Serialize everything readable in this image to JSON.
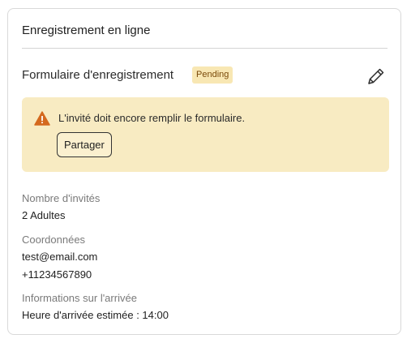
{
  "card": {
    "title": "Enregistrement en ligne"
  },
  "form": {
    "title": "Formulaire d'enregistrement",
    "status_badge": "Pending"
  },
  "alert": {
    "message": "L'invité doit encore remplir le formulaire.",
    "share_label": "Partager"
  },
  "details": {
    "guests_label": "Nombre d'invités",
    "guests_value": "2 Adultes",
    "contact_label": "Coordonnées",
    "email": "test@email.com",
    "phone": "+11234567890",
    "arrival_label": "Informations sur l'arrivée",
    "arrival_value": "Heure d'arrivée estimée : 14:00"
  },
  "colors": {
    "badge_bg": "#f8e7b3",
    "alert_bg": "#f8ebc2",
    "warning_icon": "#d4691e"
  },
  "icons": {
    "edit": "pencil-icon",
    "alert": "warning-icon"
  }
}
